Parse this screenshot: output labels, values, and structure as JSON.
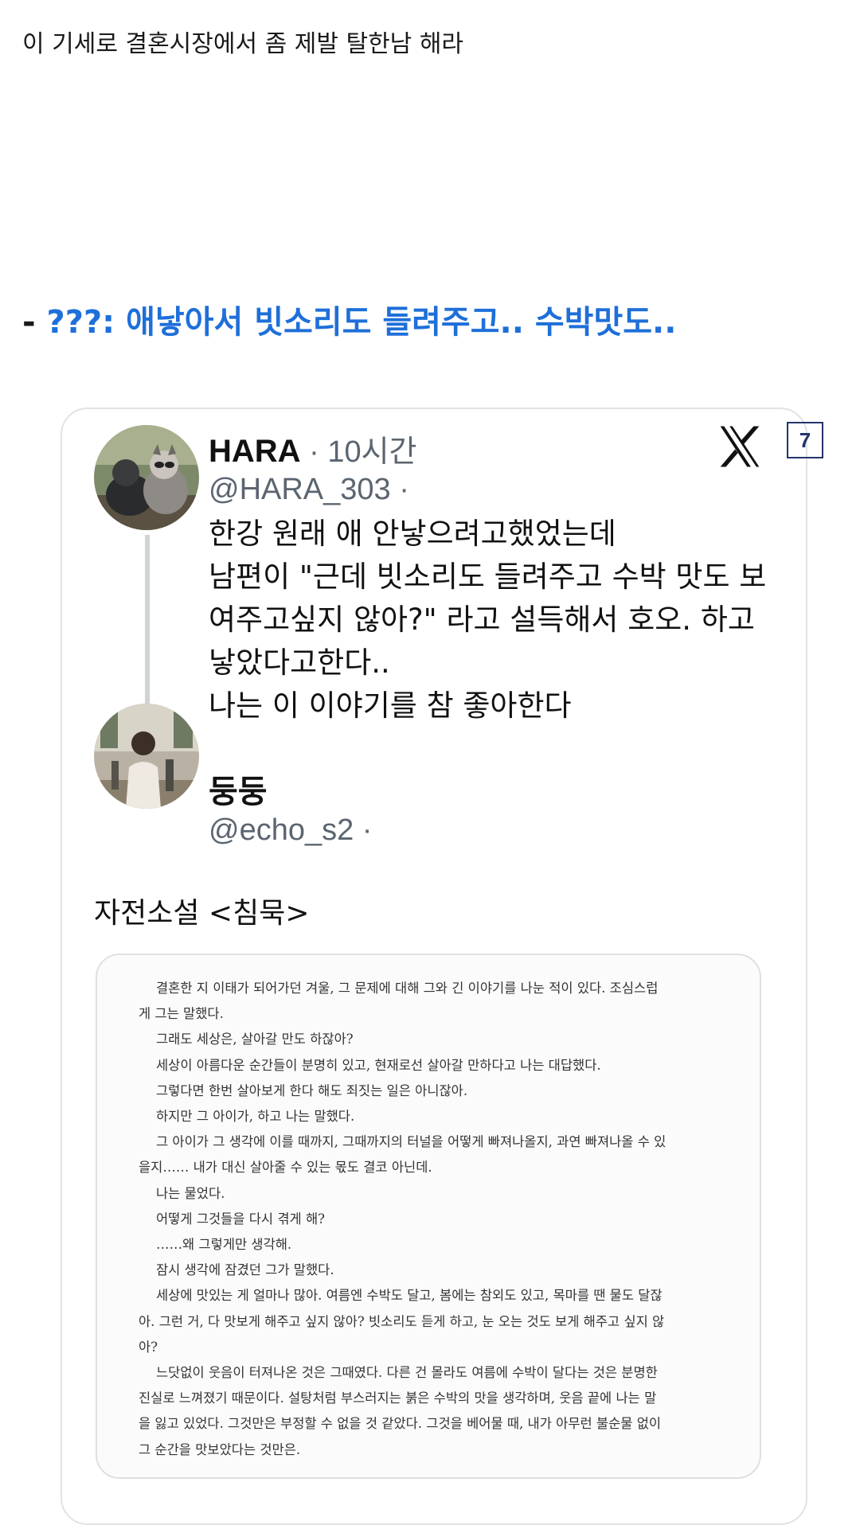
{
  "post": {
    "intro_text": "이 기세로 결혼시장에서 좀 제발 탈한남 해라",
    "section_dash": "-",
    "section_title": "???: 애낳아서 빗소리도 들려주고.. 수박맛도.."
  },
  "embed": {
    "platform_icon": "x-logo-icon",
    "badge_number": "7",
    "tweet": {
      "display_name": "HARA",
      "meta": " · 10시간",
      "handle": "@HARA_303 ·",
      "avatar": "raccoon-avatar",
      "lines": [
        "한강 원래 애 안낳으려고했었는데",
        "남편이 \"근데 빗소리도 들려주고 수박 맛도 보",
        "여주고싶지 않아?\" 라고 설득해서 호오. 하고",
        "낳았다고한다..",
        "나는 이 이야기를 참 좋아한다"
      ]
    },
    "reply": {
      "display_name": "둥둥",
      "handle": "@echo_s2 ·",
      "avatar": "portrait-avatar",
      "text": "자전소설 <침묵>"
    },
    "excerpt": {
      "lines": [
        {
          "text": "결혼한 지 이태가 되어가던 겨울, 그 문제에 대해 그와 긴 이야기를 나눈 적이 있다. 조심스럽",
          "indent": true
        },
        {
          "text": "게 그는 말했다.",
          "indent": false
        },
        {
          "text": "그래도 세상은, 살아갈 만도 하잖아?",
          "indent": true
        },
        {
          "text": "세상이 아름다운 순간들이 분명히 있고, 현재로선 살아갈 만하다고 나는 대답했다.",
          "indent": true
        },
        {
          "text": "그렇다면 한번 살아보게 한다 해도 죄짓는 일은 아니잖아.",
          "indent": true
        },
        {
          "text": "하지만 그 아이가, 하고 나는 말했다.",
          "indent": true
        },
        {
          "text": "그 아이가 그 생각에 이를 때까지, 그때까지의 터널을 어떻게 빠져나올지, 과연 빠져나올 수 있",
          "indent": true
        },
        {
          "text": "을지…… 내가 대신 살아줄 수 있는 몫도 결코 아닌데.",
          "indent": false
        },
        {
          "text": "나는 물었다.",
          "indent": true
        },
        {
          "text": "어떻게 그것들을 다시 겪게 해?",
          "indent": true
        },
        {
          "text": "……왜 그렇게만 생각해.",
          "indent": true
        },
        {
          "text": "잠시 생각에 잠겼던 그가 말했다.",
          "indent": true
        },
        {
          "text": "세상에 맛있는 게 얼마나 많아. 여름엔 수박도 달고, 봄에는 참외도 있고, 목마를 땐 물도 달잖",
          "indent": true
        },
        {
          "text": "아. 그런 거, 다 맛보게 해주고 싶지 않아? 빗소리도 듣게 하고, 눈 오는 것도 보게 해주고 싶지 않",
          "indent": false
        },
        {
          "text": "아?",
          "indent": false
        },
        {
          "text": "느닷없이 웃음이 터져나온 것은 그때였다. 다른 건 몰라도 여름에 수박이 달다는 것은 분명한",
          "indent": true
        },
        {
          "text": "진실로 느껴졌기 때문이다. 설탕처럼 부스러지는 붉은 수박의 맛을 생각하며, 웃음 끝에 나는 말",
          "indent": false
        },
        {
          "text": "을 잃고 있었다. 그것만은 부정할 수 없을 것 같았다. 그것을 베어물 때, 내가 아무런 불순물 없이",
          "indent": false
        },
        {
          "text": "그 순간을 맛보았다는 것만은.",
          "indent": false
        }
      ]
    }
  }
}
